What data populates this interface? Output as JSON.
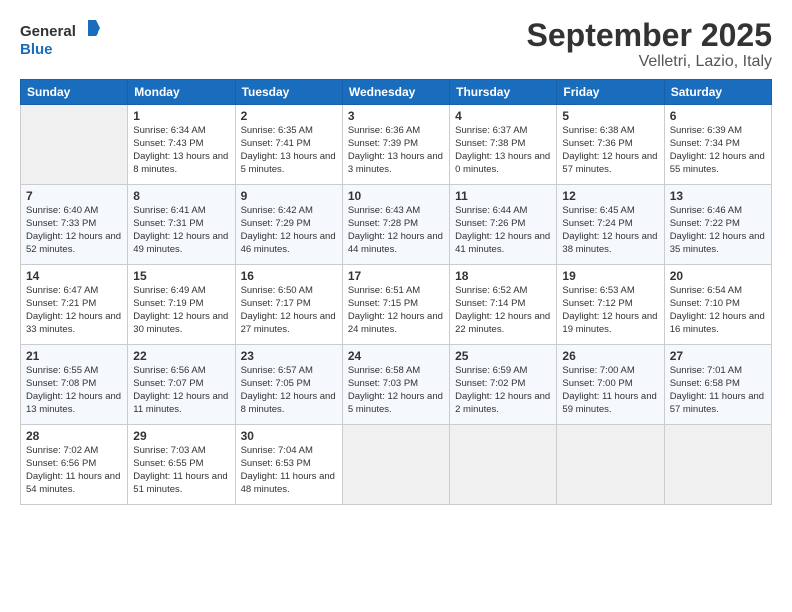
{
  "header": {
    "logo_general": "General",
    "logo_blue": "Blue",
    "title": "September 2025",
    "subtitle": "Velletri, Lazio, Italy"
  },
  "days_of_week": [
    "Sunday",
    "Monday",
    "Tuesday",
    "Wednesday",
    "Thursday",
    "Friday",
    "Saturday"
  ],
  "weeks": [
    [
      {
        "day": "",
        "empty": true
      },
      {
        "day": "1",
        "sunrise": "Sunrise: 6:34 AM",
        "sunset": "Sunset: 7:43 PM",
        "daylight": "Daylight: 13 hours and 8 minutes."
      },
      {
        "day": "2",
        "sunrise": "Sunrise: 6:35 AM",
        "sunset": "Sunset: 7:41 PM",
        "daylight": "Daylight: 13 hours and 5 minutes."
      },
      {
        "day": "3",
        "sunrise": "Sunrise: 6:36 AM",
        "sunset": "Sunset: 7:39 PM",
        "daylight": "Daylight: 13 hours and 3 minutes."
      },
      {
        "day": "4",
        "sunrise": "Sunrise: 6:37 AM",
        "sunset": "Sunset: 7:38 PM",
        "daylight": "Daylight: 13 hours and 0 minutes."
      },
      {
        "day": "5",
        "sunrise": "Sunrise: 6:38 AM",
        "sunset": "Sunset: 7:36 PM",
        "daylight": "Daylight: 12 hours and 57 minutes."
      },
      {
        "day": "6",
        "sunrise": "Sunrise: 6:39 AM",
        "sunset": "Sunset: 7:34 PM",
        "daylight": "Daylight: 12 hours and 55 minutes."
      }
    ],
    [
      {
        "day": "7",
        "sunrise": "Sunrise: 6:40 AM",
        "sunset": "Sunset: 7:33 PM",
        "daylight": "Daylight: 12 hours and 52 minutes."
      },
      {
        "day": "8",
        "sunrise": "Sunrise: 6:41 AM",
        "sunset": "Sunset: 7:31 PM",
        "daylight": "Daylight: 12 hours and 49 minutes."
      },
      {
        "day": "9",
        "sunrise": "Sunrise: 6:42 AM",
        "sunset": "Sunset: 7:29 PM",
        "daylight": "Daylight: 12 hours and 46 minutes."
      },
      {
        "day": "10",
        "sunrise": "Sunrise: 6:43 AM",
        "sunset": "Sunset: 7:28 PM",
        "daylight": "Daylight: 12 hours and 44 minutes."
      },
      {
        "day": "11",
        "sunrise": "Sunrise: 6:44 AM",
        "sunset": "Sunset: 7:26 PM",
        "daylight": "Daylight: 12 hours and 41 minutes."
      },
      {
        "day": "12",
        "sunrise": "Sunrise: 6:45 AM",
        "sunset": "Sunset: 7:24 PM",
        "daylight": "Daylight: 12 hours and 38 minutes."
      },
      {
        "day": "13",
        "sunrise": "Sunrise: 6:46 AM",
        "sunset": "Sunset: 7:22 PM",
        "daylight": "Daylight: 12 hours and 35 minutes."
      }
    ],
    [
      {
        "day": "14",
        "sunrise": "Sunrise: 6:47 AM",
        "sunset": "Sunset: 7:21 PM",
        "daylight": "Daylight: 12 hours and 33 minutes."
      },
      {
        "day": "15",
        "sunrise": "Sunrise: 6:49 AM",
        "sunset": "Sunset: 7:19 PM",
        "daylight": "Daylight: 12 hours and 30 minutes."
      },
      {
        "day": "16",
        "sunrise": "Sunrise: 6:50 AM",
        "sunset": "Sunset: 7:17 PM",
        "daylight": "Daylight: 12 hours and 27 minutes."
      },
      {
        "day": "17",
        "sunrise": "Sunrise: 6:51 AM",
        "sunset": "Sunset: 7:15 PM",
        "daylight": "Daylight: 12 hours and 24 minutes."
      },
      {
        "day": "18",
        "sunrise": "Sunrise: 6:52 AM",
        "sunset": "Sunset: 7:14 PM",
        "daylight": "Daylight: 12 hours and 22 minutes."
      },
      {
        "day": "19",
        "sunrise": "Sunrise: 6:53 AM",
        "sunset": "Sunset: 7:12 PM",
        "daylight": "Daylight: 12 hours and 19 minutes."
      },
      {
        "day": "20",
        "sunrise": "Sunrise: 6:54 AM",
        "sunset": "Sunset: 7:10 PM",
        "daylight": "Daylight: 12 hours and 16 minutes."
      }
    ],
    [
      {
        "day": "21",
        "sunrise": "Sunrise: 6:55 AM",
        "sunset": "Sunset: 7:08 PM",
        "daylight": "Daylight: 12 hours and 13 minutes."
      },
      {
        "day": "22",
        "sunrise": "Sunrise: 6:56 AM",
        "sunset": "Sunset: 7:07 PM",
        "daylight": "Daylight: 12 hours and 11 minutes."
      },
      {
        "day": "23",
        "sunrise": "Sunrise: 6:57 AM",
        "sunset": "Sunset: 7:05 PM",
        "daylight": "Daylight: 12 hours and 8 minutes."
      },
      {
        "day": "24",
        "sunrise": "Sunrise: 6:58 AM",
        "sunset": "Sunset: 7:03 PM",
        "daylight": "Daylight: 12 hours and 5 minutes."
      },
      {
        "day": "25",
        "sunrise": "Sunrise: 6:59 AM",
        "sunset": "Sunset: 7:02 PM",
        "daylight": "Daylight: 12 hours and 2 minutes."
      },
      {
        "day": "26",
        "sunrise": "Sunrise: 7:00 AM",
        "sunset": "Sunset: 7:00 PM",
        "daylight": "Daylight: 11 hours and 59 minutes."
      },
      {
        "day": "27",
        "sunrise": "Sunrise: 7:01 AM",
        "sunset": "Sunset: 6:58 PM",
        "daylight": "Daylight: 11 hours and 57 minutes."
      }
    ],
    [
      {
        "day": "28",
        "sunrise": "Sunrise: 7:02 AM",
        "sunset": "Sunset: 6:56 PM",
        "daylight": "Daylight: 11 hours and 54 minutes."
      },
      {
        "day": "29",
        "sunrise": "Sunrise: 7:03 AM",
        "sunset": "Sunset: 6:55 PM",
        "daylight": "Daylight: 11 hours and 51 minutes."
      },
      {
        "day": "30",
        "sunrise": "Sunrise: 7:04 AM",
        "sunset": "Sunset: 6:53 PM",
        "daylight": "Daylight: 11 hours and 48 minutes."
      },
      {
        "day": "",
        "empty": true
      },
      {
        "day": "",
        "empty": true
      },
      {
        "day": "",
        "empty": true
      },
      {
        "day": "",
        "empty": true
      }
    ]
  ]
}
